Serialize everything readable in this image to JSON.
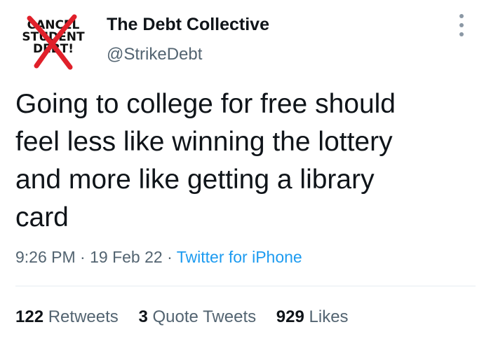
{
  "profile": {
    "avatar_lines": [
      "CANCEL",
      "STUDENT",
      "DEBT!"
    ],
    "display_name": "The Debt Collective",
    "handle": "@StrikeDebt"
  },
  "tweet": {
    "text": "Going to college for free should\nfeel less like winning the lottery\nand more like getting a library\ncard",
    "time": "9:26 PM",
    "date": "19 Feb 22",
    "separator": "·",
    "source": "Twitter for iPhone"
  },
  "stats": [
    {
      "count": "122",
      "label": "Retweets"
    },
    {
      "count": "3",
      "label": "Quote Tweets"
    },
    {
      "count": "929",
      "label": "Likes"
    }
  ],
  "colors": {
    "text": "#0f1419",
    "secondary": "#536471",
    "link": "#1d9bf0",
    "avatar_cross": "#e0202a"
  },
  "icons": {
    "more": "more-horizontal-icon"
  }
}
